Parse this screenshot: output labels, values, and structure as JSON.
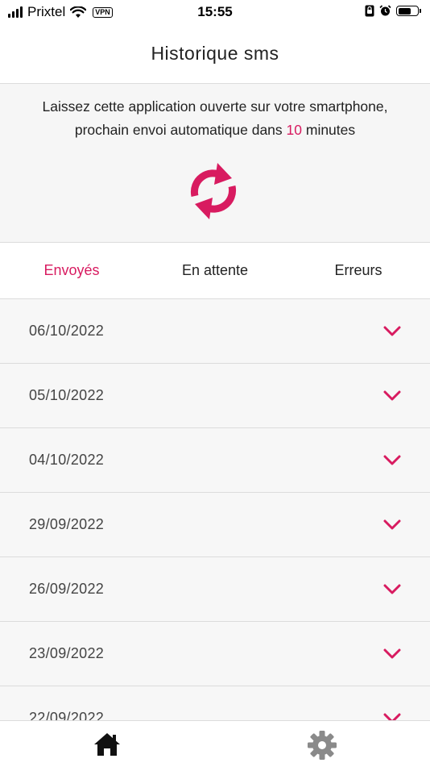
{
  "status_bar": {
    "carrier": "Prixtel",
    "vpn": "VPN",
    "time": "15:55"
  },
  "header": {
    "title": "Historique sms"
  },
  "info": {
    "line1": "Laissez cette application ouverte sur votre smartphone,",
    "line2_prefix": "prochain envoi automatique dans ",
    "minutes": "10",
    "line2_suffix": " minutes"
  },
  "tabs": [
    {
      "label": "Envoyés",
      "active": true
    },
    {
      "label": "En attente",
      "active": false
    },
    {
      "label": "Erreurs",
      "active": false
    }
  ],
  "history": [
    {
      "date": "06/10/2022"
    },
    {
      "date": "05/10/2022"
    },
    {
      "date": "04/10/2022"
    },
    {
      "date": "29/09/2022"
    },
    {
      "date": "26/09/2022"
    },
    {
      "date": "23/09/2022"
    },
    {
      "date": "22/09/2022"
    }
  ],
  "colors": {
    "accent": "#d81b60",
    "icon_dark": "#111111",
    "icon_grey": "#8a8a8a"
  },
  "icons": {
    "refresh": "refresh-icon",
    "expand": "chevron-down-icon",
    "home": "home-icon",
    "settings": "gear-icon"
  }
}
